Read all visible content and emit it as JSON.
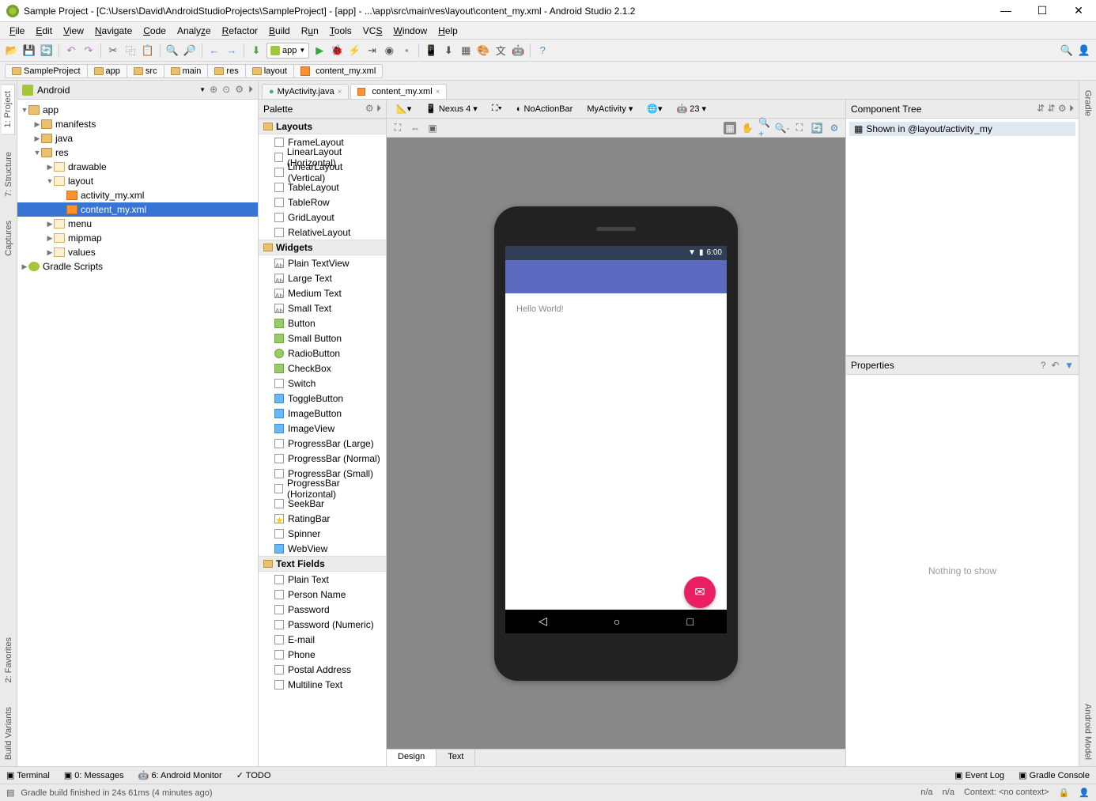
{
  "title": "Sample Project - [C:\\Users\\David\\AndroidStudioProjects\\SampleProject] - [app] - ...\\app\\src\\main\\res\\layout\\content_my.xml - Android Studio 2.1.2",
  "menu": [
    "File",
    "Edit",
    "View",
    "Navigate",
    "Code",
    "Analyze",
    "Refactor",
    "Build",
    "Run",
    "Tools",
    "VCS",
    "Window",
    "Help"
  ],
  "runconfig": "app",
  "breadcrumb": [
    "SampleProject",
    "app",
    "src",
    "main",
    "res",
    "layout",
    "content_my.xml"
  ],
  "project": {
    "label": "Android",
    "tree": {
      "app": "app",
      "manifests": "manifests",
      "java": "java",
      "res": "res",
      "drawable": "drawable",
      "layout": "layout",
      "activity_my": "activity_my.xml",
      "content_my": "content_my.xml",
      "menu": "menu",
      "mipmap": "mipmap",
      "values": "values",
      "gradle": "Gradle Scripts"
    }
  },
  "editor_tabs": {
    "t0": "MyActivity.java",
    "t1": "content_my.xml"
  },
  "palette": {
    "title": "Palette",
    "groups": {
      "layouts": "Layouts",
      "widgets": "Widgets",
      "textfields": "Text Fields"
    },
    "layouts": [
      "FrameLayout",
      "LinearLayout (Horizontal)",
      "LinearLayout (Vertical)",
      "TableLayout",
      "TableRow",
      "GridLayout",
      "RelativeLayout"
    ],
    "widgets": [
      "Plain TextView",
      "Large Text",
      "Medium Text",
      "Small Text",
      "Button",
      "Small Button",
      "RadioButton",
      "CheckBox",
      "Switch",
      "ToggleButton",
      "ImageButton",
      "ImageView",
      "ProgressBar (Large)",
      "ProgressBar (Normal)",
      "ProgressBar (Small)",
      "ProgressBar (Horizontal)",
      "SeekBar",
      "RatingBar",
      "Spinner",
      "WebView"
    ],
    "textfields": [
      "Plain Text",
      "Person Name",
      "Password",
      "Password (Numeric)",
      "E-mail",
      "Phone",
      "Postal Address",
      "Multiline Text"
    ]
  },
  "design_toolbar": {
    "device": "Nexus 4",
    "theme": "NoActionBar",
    "activity": "MyActivity",
    "api": "23"
  },
  "phone": {
    "time": "6:00",
    "hello": "Hello World!"
  },
  "design_tabs": {
    "design": "Design",
    "text": "Text"
  },
  "component_tree": {
    "title": "Component Tree",
    "item": "Shown in @layout/activity_my"
  },
  "properties": {
    "title": "Properties",
    "empty": "Nothing to show"
  },
  "left_gutter": [
    "1: Project",
    "7: Structure",
    "Captures",
    "2: Favorites",
    "Build Variants"
  ],
  "right_gutter": [
    "Gradle",
    "Android Model"
  ],
  "bottom_tabs": {
    "terminal": "Terminal",
    "messages": "0: Messages",
    "monitor": "6: Android Monitor",
    "todo": "TODO",
    "eventlog": "Event Log",
    "gradleconsole": "Gradle Console"
  },
  "status": {
    "msg": "Gradle build finished in 24s 61ms (4 minutes ago)",
    "na1": "n/a",
    "na2": "n/a",
    "ctx": "Context: <no context>"
  }
}
